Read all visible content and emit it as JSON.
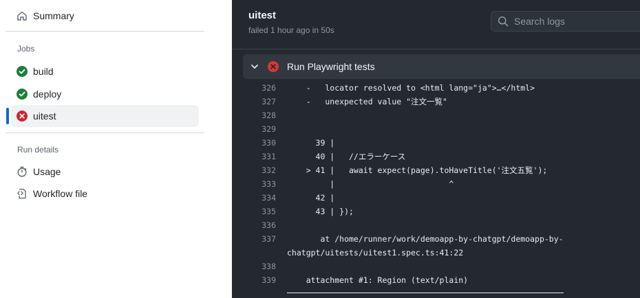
{
  "sidebar": {
    "summary_label": "Summary",
    "jobs_heading": "Jobs",
    "jobs": [
      {
        "label": "build",
        "status": "success"
      },
      {
        "label": "deploy",
        "status": "success"
      },
      {
        "label": "uitest",
        "status": "failed"
      }
    ],
    "run_details_heading": "Run details",
    "usage_label": "Usage",
    "workflow_file_label": "Workflow file"
  },
  "job": {
    "title": "uitest",
    "subtitle": "failed 1 hour ago in 50s"
  },
  "search": {
    "placeholder": "Search logs"
  },
  "step": {
    "title": "Run Playwright tests",
    "status": "failed"
  },
  "log_lines": [
    {
      "num": "326",
      "text": "    -   locator resolved to <html lang=\"ja\">…</html>"
    },
    {
      "num": "327",
      "text": "    -   unexpected value \"注文一覧\""
    },
    {
      "num": "328",
      "text": ""
    },
    {
      "num": "329",
      "text": ""
    },
    {
      "num": "330",
      "text": "      39 |"
    },
    {
      "num": "331",
      "text": "      40 |   //エラーケース"
    },
    {
      "num": "332",
      "text": "    > 41 |   await expect(page).toHaveTitle('注文五覧');"
    },
    {
      "num": "333",
      "text": "         |                        ^"
    },
    {
      "num": "334",
      "text": "      42 |"
    },
    {
      "num": "335",
      "text": "      43 | });"
    },
    {
      "num": "336",
      "text": ""
    },
    {
      "num": "337",
      "text": "       at /home/runner/work/demoapp-by-chatgpt/demoapp-by-",
      "cont": "chatgpt/uitests/uitest1.spec.ts:41:22"
    },
    {
      "num": "338",
      "text": ""
    },
    {
      "num": "339",
      "text": "    attachment #1: Region (text/plain)"
    }
  ],
  "colors": {
    "success": "#1a7f37",
    "failed": "#cf222e",
    "active_bar": "#0969da",
    "log_bg": "#24292f"
  }
}
